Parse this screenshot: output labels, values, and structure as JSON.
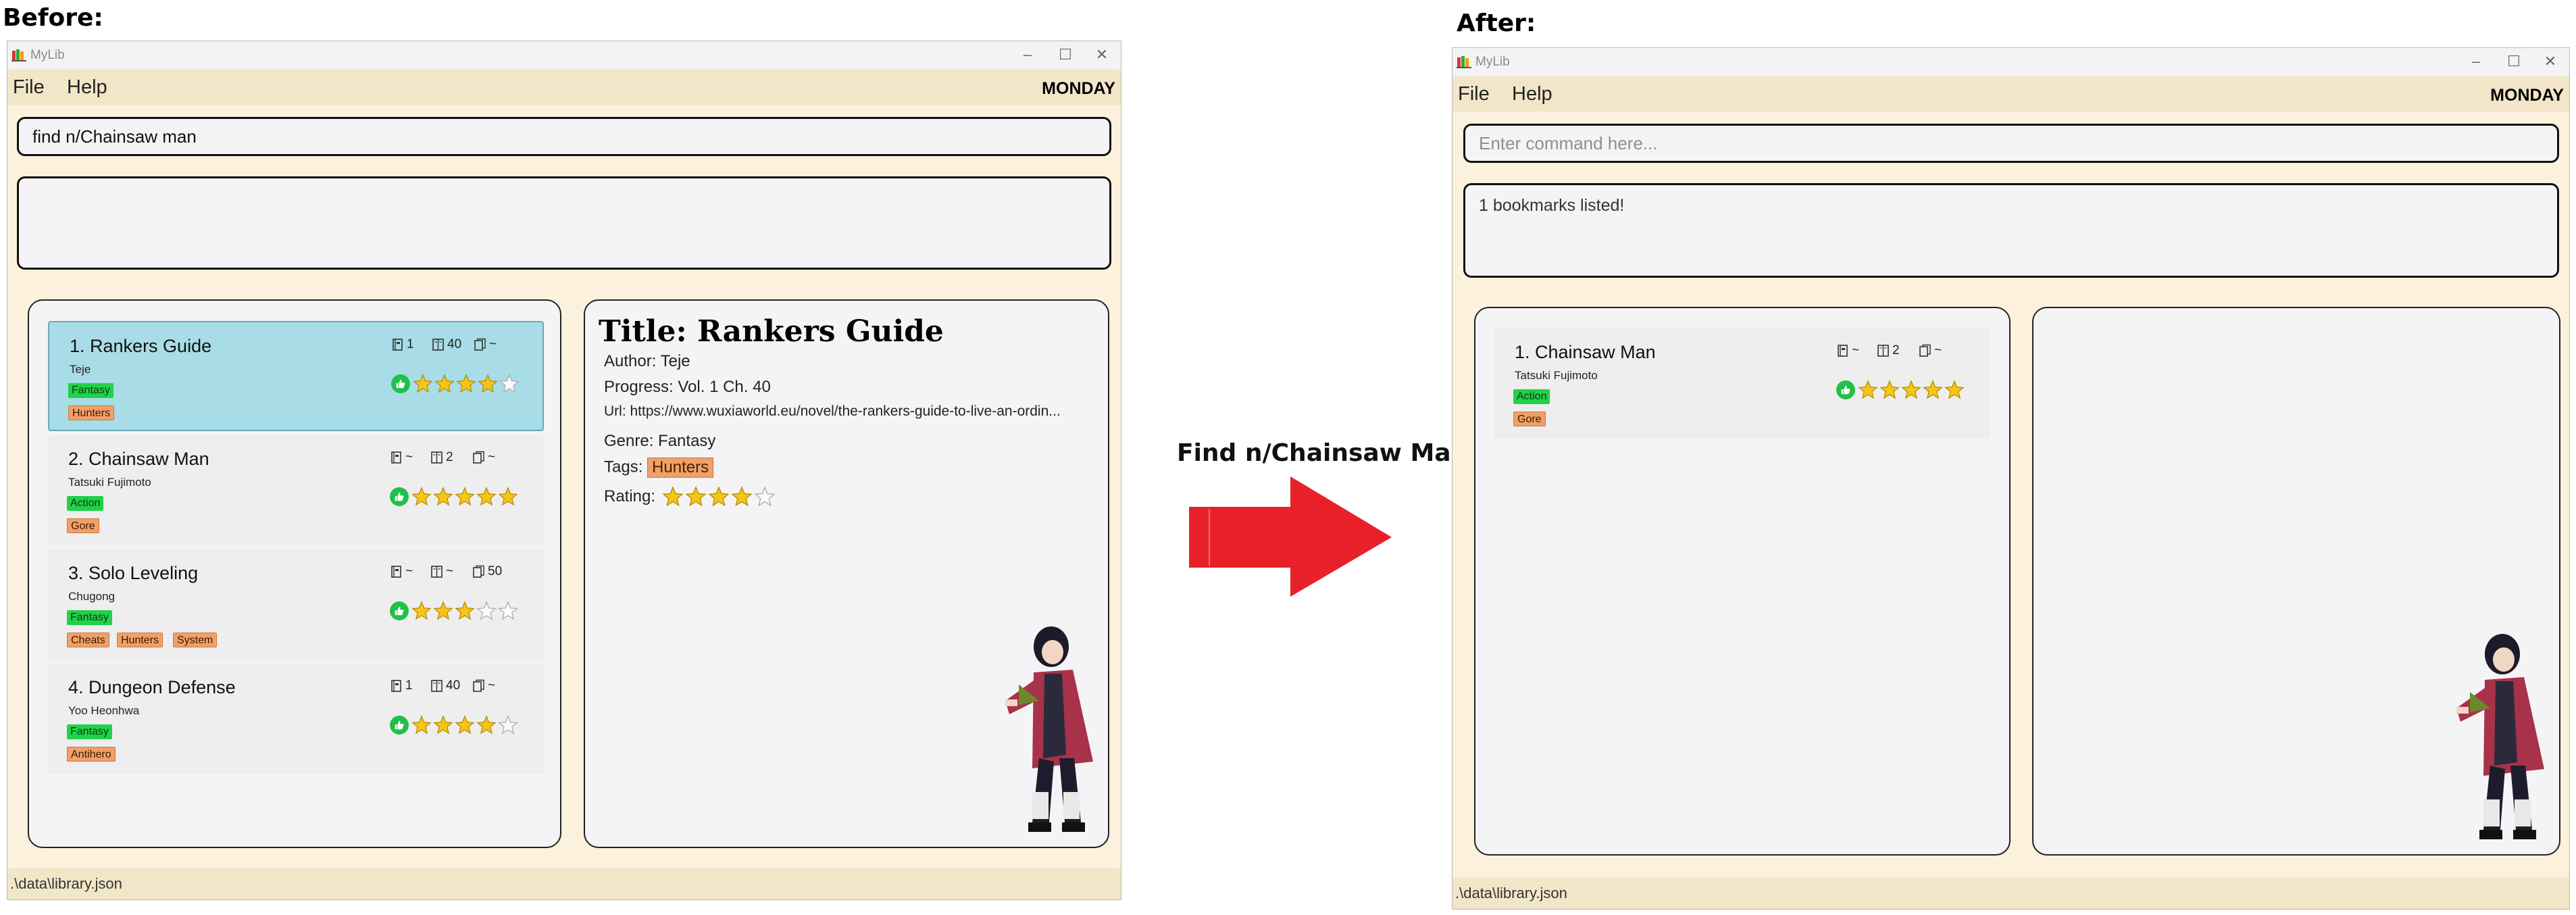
{
  "captions": {
    "before": "Before:",
    "after": "After:",
    "action": "Find n/Chainsaw Man"
  },
  "colors": {
    "window_bg": "#fbf1dc",
    "menubar_bg": "#f2e6c8",
    "selected_card": "#a8dce7",
    "genre_tag": "#21d14a",
    "tag": "#f0a068",
    "arrow": "#e8202a",
    "star": "#f5c518"
  },
  "before": {
    "app_title": "MyLib",
    "menu": {
      "file": "File",
      "help": "Help"
    },
    "day": "MONDAY",
    "command_value": "find n/Chainsaw man",
    "command_placeholder": "Enter command here...",
    "result_text": "",
    "status_path": ".\\data\\library.json",
    "cards": [
      {
        "name": "1. Rankers Guide",
        "author": "Teje",
        "genre": "Fantasy",
        "tags": [
          "Hunters"
        ],
        "volume": "1",
        "chapter": "40",
        "pages": "~",
        "rating": 4,
        "selected": true
      },
      {
        "name": "2. Chainsaw Man",
        "author": "Tatsuki Fujimoto",
        "genre": "Action",
        "tags": [
          "Gore"
        ],
        "volume": "~",
        "chapter": "2",
        "pages": "~",
        "rating": 5,
        "selected": false
      },
      {
        "name": "3. Solo Leveling",
        "author": "Chugong",
        "genre": "Fantasy",
        "tags": [
          "Cheats",
          "Hunters",
          "System"
        ],
        "volume": "~",
        "chapter": "~",
        "pages": "50",
        "rating": 3,
        "selected": false
      },
      {
        "name": "4. Dungeon Defense",
        "author": "Yoo Heonhwa",
        "genre": "Fantasy",
        "tags": [
          "Antihero"
        ],
        "volume": "1",
        "chapter": "40",
        "pages": "~",
        "rating": 4,
        "selected": false
      }
    ],
    "detail": {
      "title": "Title: Rankers Guide",
      "author": "Author: Teje",
      "progress": "Progress: Vol. 1 Ch. 40",
      "url": "Url:  https://www.wuxiaworld.eu/novel/the-rankers-guide-to-live-an-ordin...",
      "genre": "Genre: Fantasy",
      "tags_label": "Tags:",
      "tags": [
        "Hunters"
      ],
      "rating_label": "Rating:",
      "rating": 4
    }
  },
  "after": {
    "app_title": "MyLib",
    "menu": {
      "file": "File",
      "help": "Help"
    },
    "day": "MONDAY",
    "command_value": "",
    "command_placeholder": "Enter command here...",
    "result_text": "1 bookmarks listed!",
    "status_path": ".\\data\\library.json",
    "cards": [
      {
        "name": "1. Chainsaw Man",
        "author": "Tatsuki Fujimoto",
        "genre": "Action",
        "tags": [
          "Gore"
        ],
        "volume": "~",
        "chapter": "2",
        "pages": "~",
        "rating": 5,
        "selected": false
      }
    ]
  },
  "icons": {
    "app": "book-stack-icon",
    "minimize": "minimize-icon",
    "maximize": "maximize-icon",
    "close": "close-icon",
    "volume": "volume-icon",
    "chapter": "chapter-icon",
    "pages": "pages-icon",
    "like": "thumbs-up-icon",
    "star": "star-icon",
    "arrow": "right-arrow-icon",
    "character": "anime-character-image"
  }
}
